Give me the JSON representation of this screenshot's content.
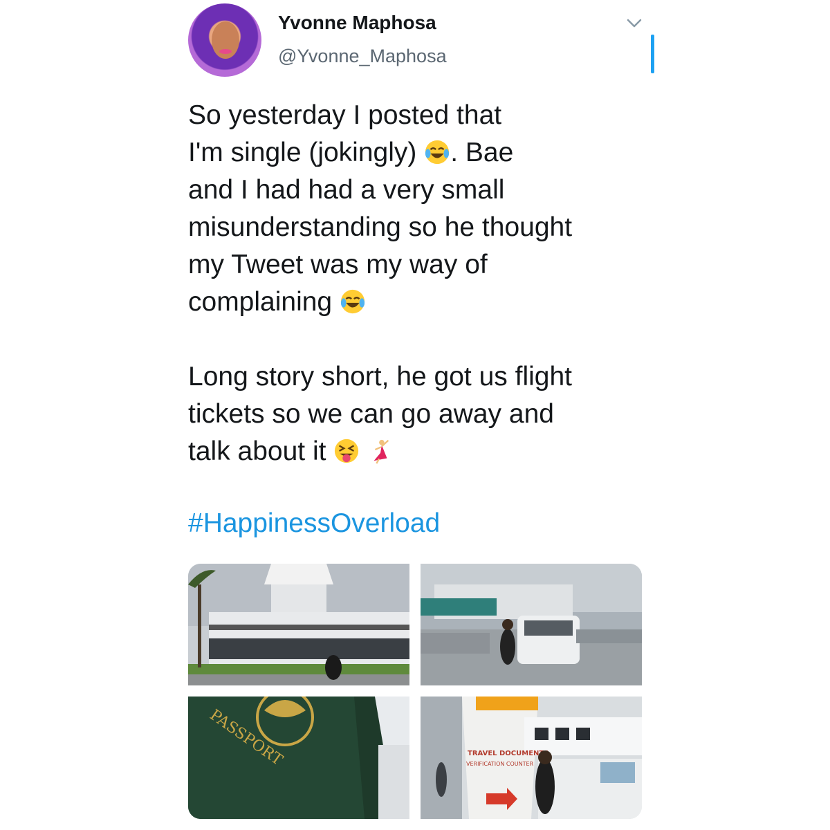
{
  "tweet": {
    "author": {
      "display_name": "Yvonne Maphosa",
      "handle": "@Yvonne_Maphosa"
    },
    "menu_icon": "chevron-down-icon",
    "text_line_1": "So yesterday I posted that",
    "text_line_2a": "I'm single (jokingly) ",
    "text_line_2b": ". Bae",
    "text_line_3": "and I had had a very small",
    "text_line_4": "misunderstanding so he thought",
    "text_line_5": "my Tweet was my way of",
    "text_line_6": "complaining ",
    "text_line_7": "Long story short, he got us flight",
    "text_line_8": "tickets so we can go away and",
    "text_line_9": "talk about it ",
    "emojis": [
      "face-with-tears-of-joy",
      "face-with-tears-of-joy",
      "squinting-face-with-tongue",
      "woman-dancing"
    ],
    "hashtag": "#HappinessOverload",
    "media": [
      {
        "description_icon": "airport-terminal-photo"
      },
      {
        "description_icon": "parking-lot-photo"
      },
      {
        "description_icon": "passport-photo",
        "text": "PASSPORT"
      },
      {
        "description_icon": "check-in-counter-photo",
        "sign_line_1": "TRAVEL DOCUMENTS",
        "sign_line_2": "VERIFICATION COUNTER"
      }
    ]
  },
  "colors": {
    "link": "#1b95e0",
    "scrollbar": "#1da1f2",
    "text": "#14171a",
    "secondary": "#5b6772"
  }
}
